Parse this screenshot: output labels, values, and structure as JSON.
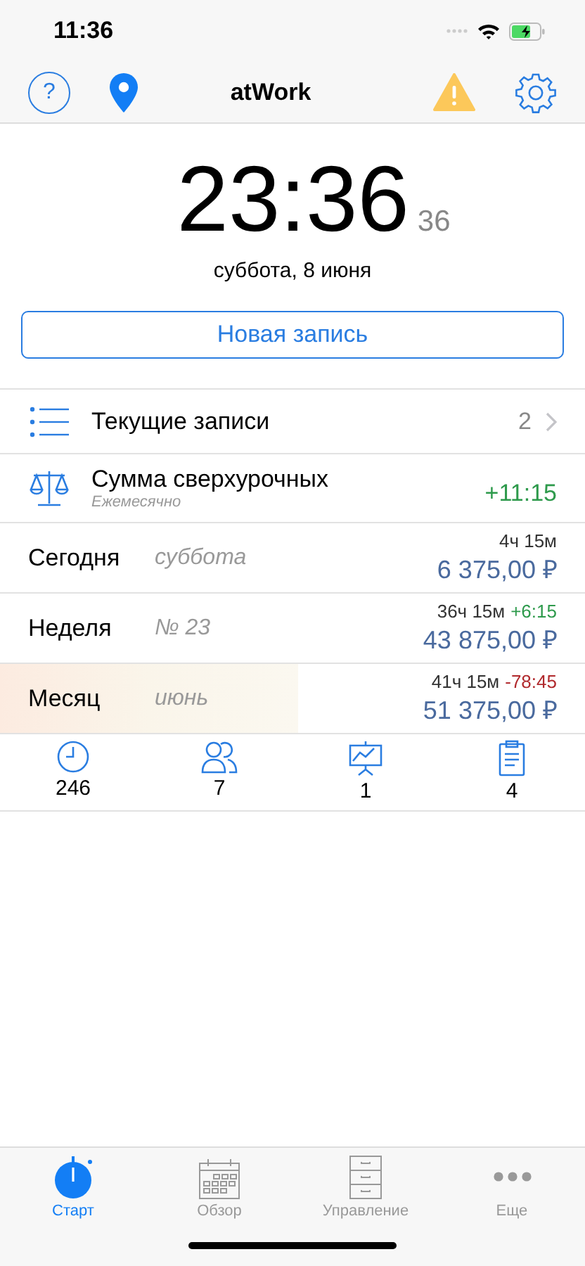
{
  "status_bar": {
    "time": "11:36"
  },
  "nav": {
    "help": "?",
    "title": "atWork"
  },
  "clock": {
    "time": "23:36",
    "seconds": "36",
    "date": "суббота, 8 июня"
  },
  "new_entry_button": "Новая запись",
  "current_entries": {
    "label": "Текущие записи",
    "count": "2"
  },
  "overtime": {
    "title": "Сумма сверхурочных",
    "subtitle": "Ежемесячно",
    "value": "+11:15"
  },
  "periods": [
    {
      "name": "Сегодня",
      "detail": "суббота",
      "hours": "4ч 15м",
      "amount": "6 375,00 ₽"
    },
    {
      "name": "Неделя",
      "detail": "№ 23",
      "hours": "36ч 15м",
      "delta": {
        "text": "+6:15",
        "kind": "positive"
      },
      "amount": "43 875,00 ₽"
    },
    {
      "name": "Месяц",
      "detail": "июнь",
      "hours": "41ч 15м",
      "delta": {
        "text": "-78:45",
        "kind": "negative"
      },
      "amount": "51 375,00 ₽",
      "level": 0.51
    }
  ],
  "stats": [
    {
      "kind": "clock",
      "value": "246"
    },
    {
      "kind": "people",
      "value": "7"
    },
    {
      "kind": "chart",
      "value": "1"
    },
    {
      "kind": "clipboard",
      "value": "4"
    }
  ],
  "tabs": [
    {
      "kind": "start",
      "label": "Старт",
      "selected": true
    },
    {
      "kind": "calendar",
      "label": "Обзор",
      "selected": false
    },
    {
      "kind": "drawers",
      "label": "Управление",
      "selected": false
    },
    {
      "kind": "more",
      "label": "Еще",
      "selected": false
    }
  ]
}
